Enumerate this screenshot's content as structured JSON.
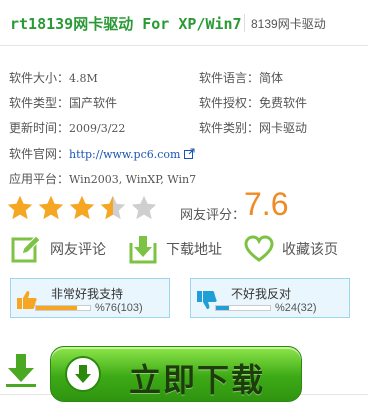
{
  "header": {
    "title": "rt18139网卡驱动 For XP/Win7",
    "subtitle": "8139网卡驱动"
  },
  "info": {
    "size_label": "软件大小：",
    "size_value": "4.8M",
    "lang_label": "软件语言：",
    "lang_value": "简体",
    "type_label": "软件类型：",
    "type_value": "国产软件",
    "license_label": "软件授权：",
    "license_value": "免费软件",
    "update_label": "更新时间：",
    "update_value": "2009/3/22",
    "category_label": "软件类别：",
    "category_value": "网卡驱动",
    "site_label": "软件官网：",
    "site_value": "http://www.pc6.com",
    "platform_label": "应用平台：",
    "platform_value": "Win2003, WinXP, Win7"
  },
  "rating": {
    "stars_filled": 3.5,
    "stars_total": 5,
    "label": "网友评分：",
    "score": "7.6"
  },
  "actions": {
    "review": "网友评论",
    "download_address": "下载地址",
    "favorite": "收藏该页"
  },
  "votes": {
    "support_label": "非常好我支持",
    "support_pct": "%76(103)",
    "support_value": 0.76,
    "oppose_label": "不好我反对",
    "oppose_pct": "%24(32)",
    "oppose_value": 0.24
  },
  "download": {
    "label": "立即下载"
  },
  "colors": {
    "title_green": "#2a9a36",
    "score_orange": "#f08a24",
    "star": "#f5a623",
    "support_bar": "#f5a623",
    "oppose_bar": "#1f9fd6",
    "link": "#1a55b5"
  }
}
